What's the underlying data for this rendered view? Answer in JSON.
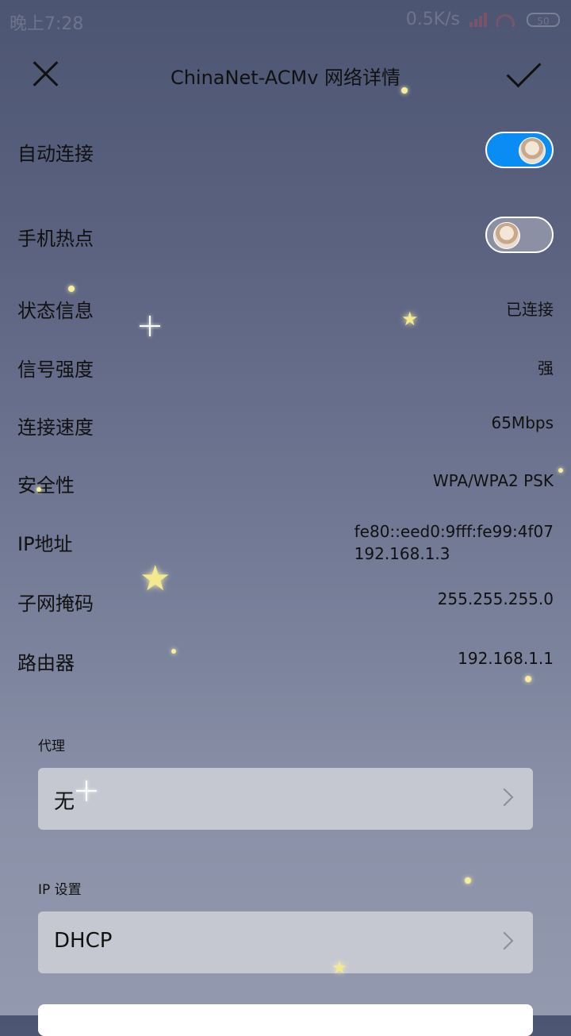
{
  "status_bar": {
    "time": "晚上7:28",
    "speed": "0.5K/s",
    "battery": "50"
  },
  "header": {
    "title": "ChinaNet-ACMv 网络详情"
  },
  "toggles": {
    "auto_connect": {
      "label": "自动连接",
      "on": true
    },
    "hotspot": {
      "label": "手机热点",
      "on": false
    }
  },
  "info": {
    "status": {
      "label": "状态信息",
      "value": "已连接"
    },
    "signal": {
      "label": "信号强度",
      "value": "强"
    },
    "speed": {
      "label": "连接速度",
      "value": "65Mbps"
    },
    "security": {
      "label": "安全性",
      "value": "WPA/WPA2 PSK"
    },
    "ip": {
      "label": "IP地址",
      "value_v6": "fe80::eed0:9fff:fe99:4f07",
      "value_v4": "192.168.1.3"
    },
    "subnet": {
      "label": "子网掩码",
      "value": "255.255.255.0"
    },
    "router": {
      "label": "路由器",
      "value": "192.168.1.1"
    }
  },
  "proxy": {
    "section_label": "代理",
    "value": "无"
  },
  "ip_settings": {
    "section_label": "IP 设置",
    "value": "DHCP"
  },
  "colors": {
    "toggle_on": "#0a8cf5",
    "select_bg": "#c5c8d1"
  }
}
